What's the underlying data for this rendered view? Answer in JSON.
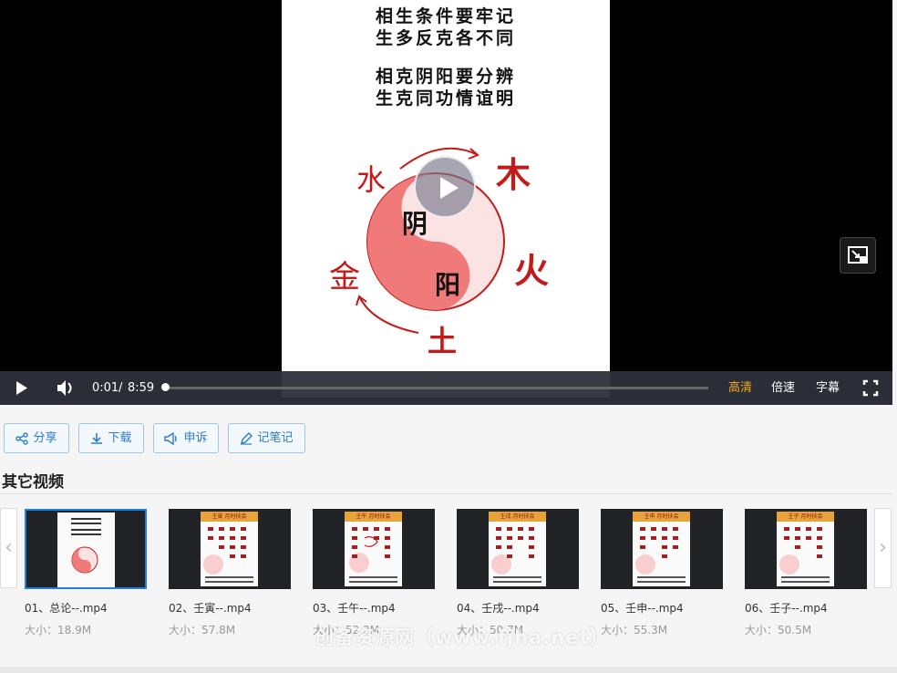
{
  "video": {
    "poem_lines": [
      "相生条件要牢记",
      "生多反克各不同",
      "相克阴阳要分辨",
      "生克同功情谊明"
    ],
    "diagram_labels": {
      "wood": "木",
      "fire": "火",
      "earth": "土",
      "metal": "金",
      "water": "水",
      "yin": "阴",
      "yang": "阳"
    },
    "current_time": "0:01",
    "time_separator": "/",
    "duration": "8:59",
    "progress_fraction": 0.004,
    "quality_label": "高清",
    "speed_label": "倍速",
    "subtitle_label": "字幕",
    "colors": {
      "quality_active": "#f5a623",
      "diagram_red": "#c41a1a"
    }
  },
  "actions": [
    {
      "icon": "share-icon",
      "label": "分享"
    },
    {
      "icon": "download-icon",
      "label": "下载"
    },
    {
      "icon": "megaphone-icon",
      "label": "申诉"
    },
    {
      "icon": "edit-icon",
      "label": "记笔记"
    }
  ],
  "other_videos": {
    "title": "其它视频",
    "items": [
      {
        "name": "01、总论--.mp4",
        "size": "大小：18.9M",
        "active": true
      },
      {
        "name": "02、壬寅--.mp4",
        "size": "大小：57.8M",
        "thumb_title": "壬寅 月时扶会"
      },
      {
        "name": "03、壬午--.mp4",
        "size": "大小：52.2M",
        "thumb_title": "壬午 月时扶会"
      },
      {
        "name": "04、壬戌--.mp4",
        "size": "大小：50.7M",
        "thumb_title": "壬戌 月时扶会"
      },
      {
        "name": "05、壬申--.mp4",
        "size": "大小：55.3M",
        "thumb_title": "壬申 月时扶会"
      },
      {
        "name": "06、壬子--.mp4",
        "size": "大小：50.5M",
        "thumb_title": "壬子 月时扶会"
      }
    ]
  },
  "watermark": "创备资源网（www.fjha.net）"
}
